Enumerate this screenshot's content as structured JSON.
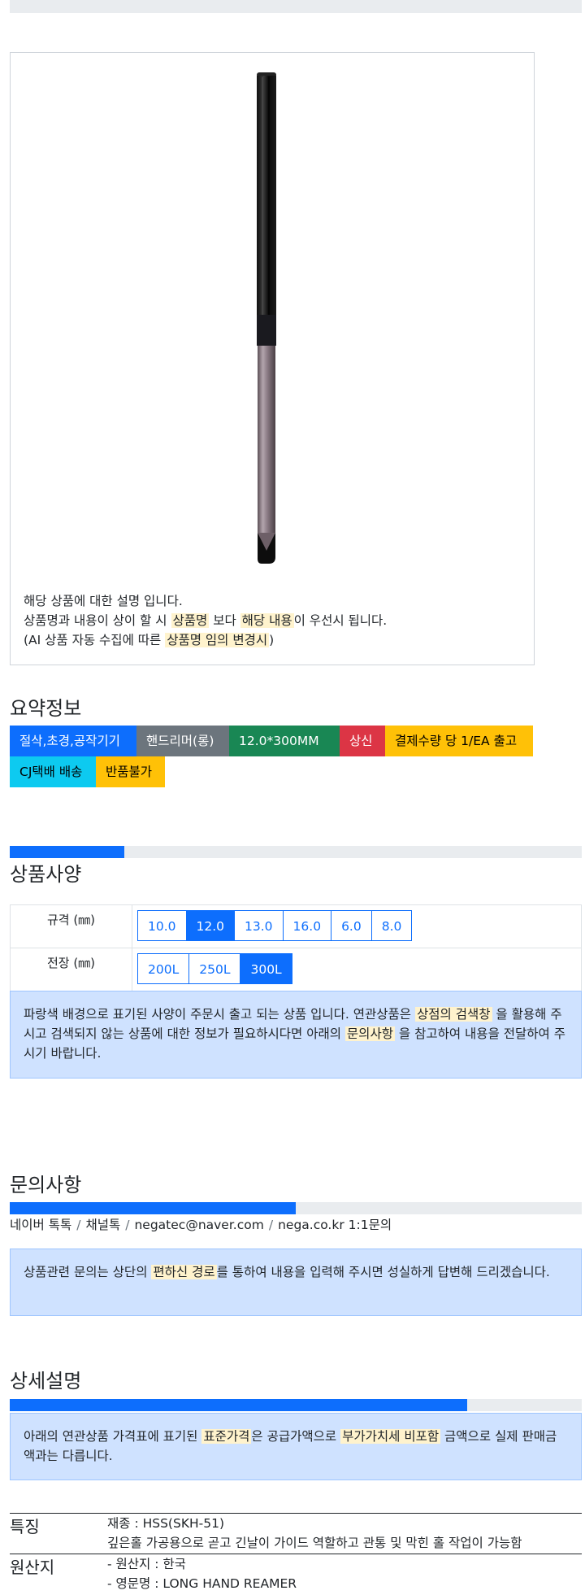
{
  "product": {
    "description_lines": [
      "해당 상품에 대한 설명 입니다.",
      {
        "pre": "상품명과 내용이 상이 할 시 ",
        "hl1": "상품명",
        "mid": " 보다 ",
        "hl2": "해당 내용",
        "post": "이 우선시 됩니다."
      },
      {
        "pre": "(AI 상품 자동 수집에 따른 ",
        "hl": "상품명 임의 변경시",
        "post": ")"
      }
    ]
  },
  "summary": {
    "title": "요약정보",
    "badges": [
      {
        "label": "절삭,초경,공작기기",
        "bg": "#0d6efd",
        "fg": "#ffffff"
      },
      {
        "label": "핸드리머(롱)",
        "bg": "#6c757d",
        "fg": "#ffffff"
      },
      {
        "label": "12.0*300MM",
        "bg": "#198754",
        "fg": "#ffffff"
      },
      {
        "label": "상신",
        "bg": "#dc3545",
        "fg": "#ffffff"
      },
      {
        "label": "결제수량 당 1/EA 출고",
        "bg": "#ffc107",
        "fg": "#000000"
      },
      {
        "label": "CJ택배 배송",
        "bg": "#0dcaf0",
        "fg": "#000000"
      },
      {
        "label": "반품불가",
        "bg": "#ffc107",
        "fg": "#000000"
      }
    ]
  },
  "specs": {
    "title": "상품사양",
    "progress": 0.2,
    "rows": [
      {
        "label": "규격 (㎜)",
        "options": [
          "10.0",
          "12.0",
          "13.0",
          "16.0",
          "6.0",
          "8.0"
        ],
        "selected": "12.0"
      },
      {
        "label": "전장 (㎜)",
        "options": [
          "200L",
          "250L",
          "300L"
        ],
        "selected": "300L"
      }
    ],
    "notice": {
      "pre": "파랑색 배경으로 표기된 사양이 주문시 출고 되는 상품 입니다. 연관상품은 ",
      "hl1": "상점의 검색창",
      "mid": " 을 활용해 주시고 검색되지 않는 상품에 대한 정보가 필요하시다면 아래의 ",
      "hl2": "문의사항",
      "post": " 을 참고하여 내용을 전달하여 주시기 바랍니다."
    }
  },
  "inquiry": {
    "title": "문의사항",
    "progress": 0.5,
    "channels": [
      "네이버 톡톡",
      "채널톡",
      "negatec@naver.com",
      "nega.co.kr 1:1문의"
    ],
    "separator": "/",
    "notice": {
      "pre": "상품관련 문의는 상단의 ",
      "hl": "편하신 경로",
      "post": "를 통하여 내용을 입력해 주시면 성실하게 답변해 드리겠습니다."
    }
  },
  "detail": {
    "title": "상세설명",
    "progress": 0.8,
    "notice": {
      "pre": "아래의 연관상품 가격표에 표기된 ",
      "hl1": "표준가격",
      "mid": "은 공급가액으로 ",
      "hl2": "부가가치세 비포함",
      "post": " 금액으로 실제 판매금액과는 다릅니다."
    },
    "features": [
      {
        "key": "특징",
        "values": [
          "재종 : HSS(SKH-51)",
          "깊은홀 가공용으로 곧고 긴날이 가이드 역할하고 관통 및 막힌 홀 작업이 가능함"
        ]
      },
      {
        "key": "원산지",
        "values": [
          "- 원산지 : 한국",
          "- 영문명 : LONG HAND REAMER"
        ]
      }
    ]
  },
  "colors": {
    "primary": "#0d6efd",
    "highlight": "#fff3cd",
    "alert_bg": "#cfe2ff"
  }
}
